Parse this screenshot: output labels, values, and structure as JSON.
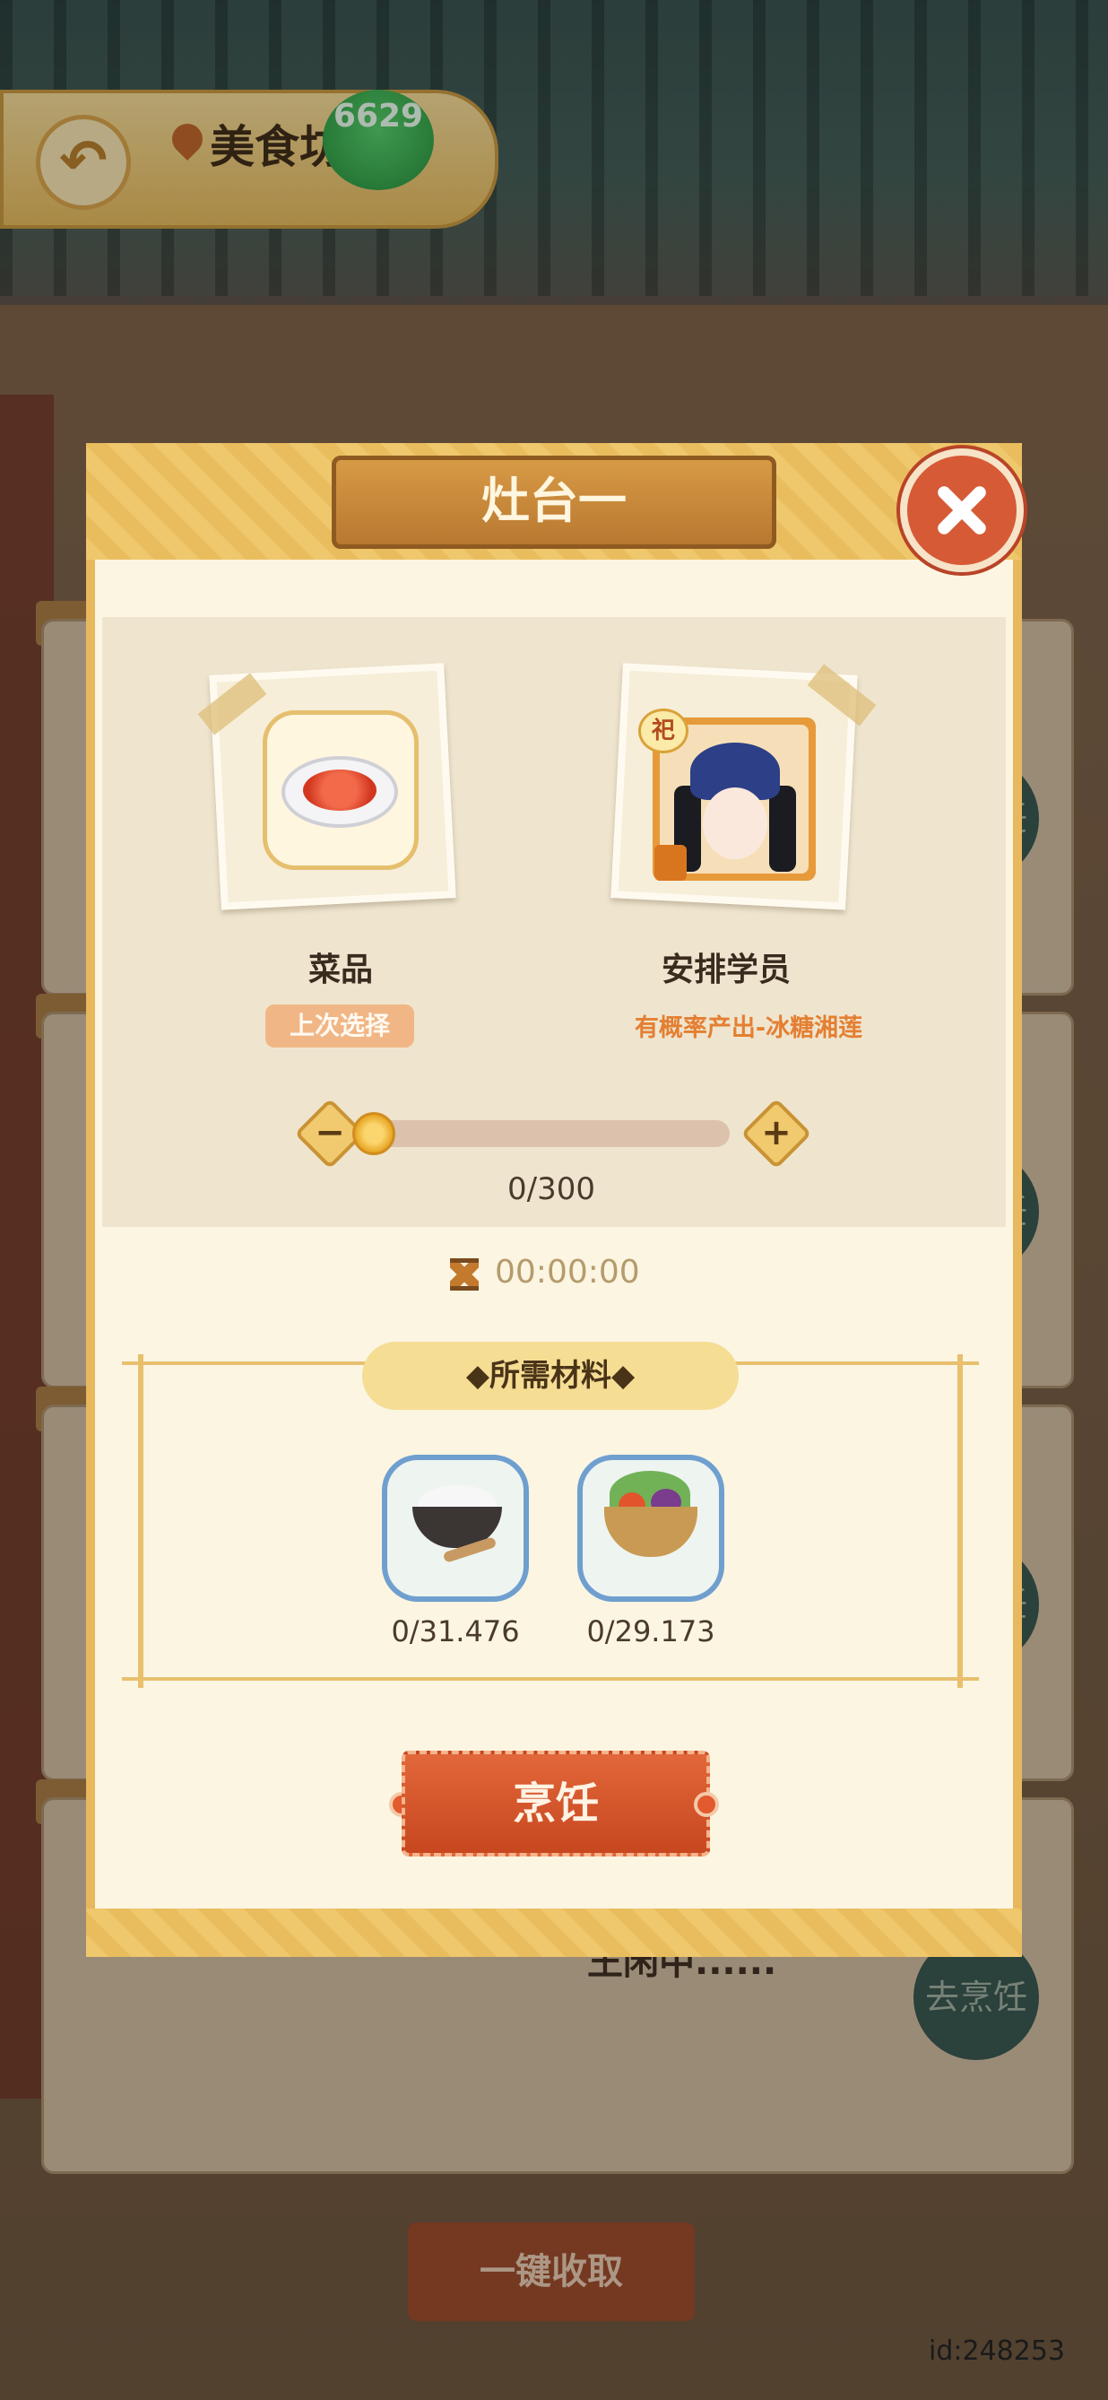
{
  "hud": {
    "title": "美食坊",
    "coin_value": "6629"
  },
  "background": {
    "side_button_label": "去烹饪",
    "cooking_hint": "王闲中......",
    "bottom_button_label": "一键收取"
  },
  "modal": {
    "title": "灶台一",
    "dish_label": "菜品",
    "last_choice_label": "上次选择",
    "student_label": "安排学员",
    "student_badge": "祀",
    "probability_text": "有概率产出-冰糖湘莲",
    "decrease_symbol": "−",
    "increase_symbol": "+",
    "quantity_counter": "0/300",
    "quantity_level": 0,
    "timer": "00:00:00",
    "materials_header": "◆所需材料◆",
    "materials": [
      {
        "icon": "flour-icon",
        "count": "0/31.476"
      },
      {
        "icon": "vegetable-basket-icon",
        "count": "0/29.173"
      }
    ],
    "cook_button_label": "烹饪"
  },
  "footer": {
    "id_text": "id:248253"
  },
  "colors": {
    "accent_gold": "#e8b85e",
    "cook_orange": "#d65a36",
    "probability_orange": "#e47f32",
    "material_slot_border": "#6f9fcf"
  }
}
